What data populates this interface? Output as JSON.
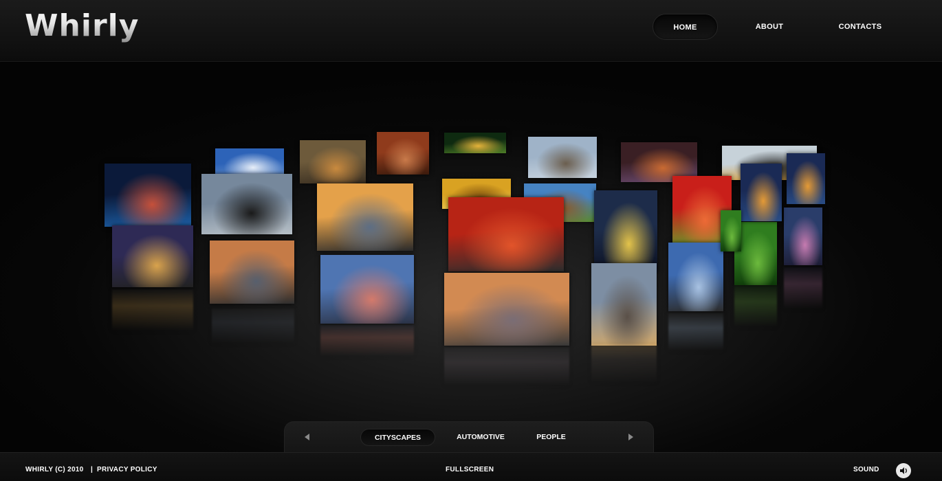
{
  "header": {
    "logo": "Whirly",
    "nav": [
      {
        "label": "HOME",
        "active": true
      },
      {
        "label": "ABOUT",
        "active": false
      },
      {
        "label": "CONTACTS",
        "active": false
      }
    ]
  },
  "gallery": {
    "description": "3D rotating carousel of photo thumbnails",
    "tiles": [
      {
        "subject": "bridge at night",
        "palette": [
          "#0b1a3a",
          "#c5503a",
          "#1d60a8"
        ]
      },
      {
        "subject": "sky with clouds",
        "palette": [
          "#2d63b8",
          "#e7eef8",
          "#6b95d0"
        ]
      },
      {
        "subject": "tiger",
        "palette": [
          "#6d5a3b",
          "#c98a3f",
          "#3a2f21"
        ]
      },
      {
        "subject": "lion cub",
        "palette": [
          "#8f3b1c",
          "#c97a4a",
          "#3b1a0c"
        ]
      },
      {
        "subject": "sunset silhouette",
        "palette": [
          "#0e2a10",
          "#e4b23a",
          "#4e7d27"
        ]
      },
      {
        "subject": "elephant",
        "palette": [
          "#9fb3c8",
          "#6b5e4e",
          "#c7d3df"
        ]
      },
      {
        "subject": "beach sunset",
        "palette": [
          "#3a1f24",
          "#c96a32",
          "#6a4a70"
        ]
      },
      {
        "subject": "penguins",
        "palette": [
          "#c7d2d9",
          "#222",
          "#d99a2c"
        ]
      },
      {
        "subject": "black car",
        "palette": [
          "#76889c",
          "#1a1a1a",
          "#b7c0c7"
        ]
      },
      {
        "subject": "mountain sunset",
        "palette": [
          "#e4a14a",
          "#5d6e84",
          "#2b2b2b"
        ]
      },
      {
        "subject": "honeycomb",
        "palette": [
          "#d9a222",
          "#7a4b0d",
          "#f0cd55"
        ]
      },
      {
        "subject": "camel desert",
        "palette": [
          "#4683c2",
          "#8a5a2c",
          "#5b8a30"
        ]
      },
      {
        "subject": "car red sky",
        "palette": [
          "#b72415",
          "#e2542a",
          "#2d2d2d"
        ]
      },
      {
        "subject": "city lights aerial",
        "palette": [
          "#1d2c4a",
          "#e3c34b",
          "#0b1020"
        ]
      },
      {
        "subject": "strawberry",
        "palette": [
          "#c91f1a",
          "#ed6a36",
          "#6a9b2b"
        ]
      },
      {
        "subject": "city skyline night",
        "palette": [
          "#1a2a55",
          "#e49a36",
          "#2a4d86"
        ]
      },
      {
        "subject": "city at dusk",
        "palette": [
          "#2e2a55",
          "#d9a34c",
          "#222"
        ]
      },
      {
        "subject": "car at dusk",
        "palette": [
          "#c57b47",
          "#575f6d",
          "#2e2e2e"
        ]
      },
      {
        "subject": "river city",
        "palette": [
          "#4f75b2",
          "#d47a6b",
          "#2b3347"
        ]
      },
      {
        "subject": "car sunset",
        "palette": [
          "#d28a52",
          "#7a6d75",
          "#3a3a3a"
        ]
      },
      {
        "subject": "green leaf",
        "palette": [
          "#2f7d1f",
          "#6cba3d",
          "#0f3a0a"
        ]
      },
      {
        "subject": "skyscraper",
        "palette": [
          "#3d6ab0",
          "#a8c2e2",
          "#2d2d2d"
        ]
      },
      {
        "subject": "sports car",
        "palette": [
          "#7d8ea3",
          "#5a5048",
          "#d2a86a"
        ]
      },
      {
        "subject": "harbour skyline",
        "palette": [
          "#2a3d6a",
          "#c67bb0",
          "#1d1d35"
        ]
      }
    ]
  },
  "categories": {
    "prev_icon": "triangle-left-icon",
    "next_icon": "triangle-right-icon",
    "items": [
      {
        "label": "CITYSCAPES",
        "active": true
      },
      {
        "label": "AUTOMOTIVE",
        "active": false
      },
      {
        "label": "PEOPLE",
        "active": false
      }
    ]
  },
  "footer": {
    "copyright": "WHIRLY (C) 2010",
    "separator": "|",
    "privacy": "PRIVACY POLICY",
    "fullscreen": "FULLSCREEN",
    "sound": "SOUND",
    "sound_icon": "speaker-icon"
  }
}
